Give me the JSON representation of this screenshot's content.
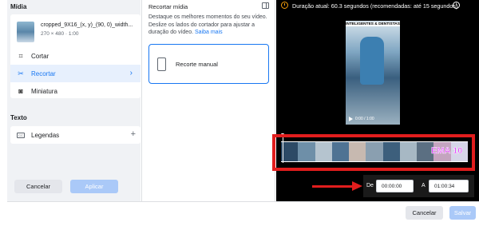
{
  "left": {
    "media_title": "Mídia",
    "file": {
      "name": "cropped_9X16_(x, y)_(90, 0)_width...",
      "meta": "270 × 480 · 1:00"
    },
    "menu": [
      {
        "label": "Cortar",
        "icon": "crop-icon",
        "active": false
      },
      {
        "label": "Recortar",
        "icon": "scissors-icon",
        "active": true
      },
      {
        "label": "Miniatura",
        "icon": "thumbnail-icon",
        "active": false
      }
    ],
    "text_title": "Texto",
    "captions": {
      "label": "Legendas",
      "icon": "cc-icon"
    }
  },
  "mid": {
    "title": "Recortar mídia",
    "description": "Destaque os melhores momentos do seu vídeo. Deslize os lados do cortador para ajustar a duração do vídeo.",
    "learn_more": "Saiba mais",
    "option_label": "Recorte manual",
    "cancel_label": "Cancelar",
    "apply_label": "Aplicar"
  },
  "video": {
    "duration_text": "Duração atual: 60.3 segundos (recomendadas: até 15 segundos)",
    "overlay_title": "INTELIGENTES & DENTISTAS",
    "time_display": "0:00 / 1:00",
    "filmstrip_text": "EMA 10",
    "from_label": "De",
    "from_value": "00:00:00",
    "to_label": "A",
    "to_value": "01:00:34"
  },
  "footer": {
    "cancel_label": "Cancelar",
    "save_label": "Salvar"
  },
  "colors": {
    "accent": "#1877f2",
    "highlight": "#e11d1d",
    "warning": "#f59e0b",
    "disabled_button": "#aac9f8"
  }
}
